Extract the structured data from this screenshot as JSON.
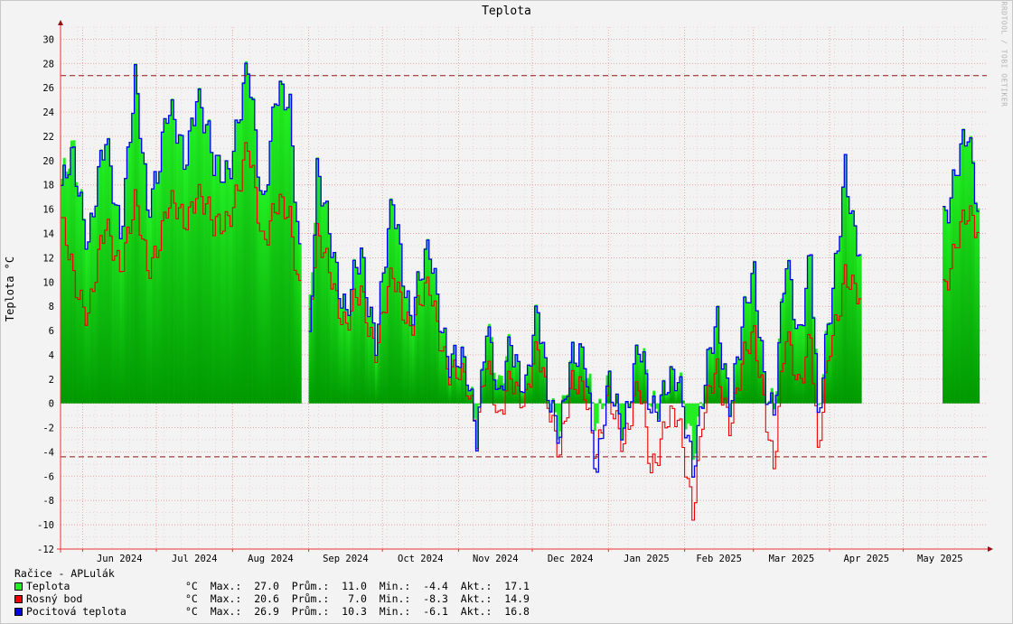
{
  "chart_data": {
    "type": "area",
    "title": "Teplota",
    "ylabel": "Teplota °C",
    "ylim": [
      -12,
      31
    ],
    "ytick_step": 2,
    "grid": true,
    "x_start": "2024-05-23",
    "x_end": "2025-06-04",
    "month_labels": [
      {
        "label": "Jun 2024",
        "date": "2024-06-01"
      },
      {
        "label": "Jul 2024",
        "date": "2024-07-01"
      },
      {
        "label": "Aug 2024",
        "date": "2024-08-01"
      },
      {
        "label": "Sep 2024",
        "date": "2024-09-01"
      },
      {
        "label": "Oct 2024",
        "date": "2024-10-01"
      },
      {
        "label": "Nov 2024",
        "date": "2024-11-01"
      },
      {
        "label": "Dec 2024",
        "date": "2024-12-01"
      },
      {
        "label": "Jan 2025",
        "date": "2025-01-01"
      },
      {
        "label": "Feb 2025",
        "date": "2025-02-01"
      },
      {
        "label": "Mar 2025",
        "date": "2025-03-01"
      },
      {
        "label": "Apr 2025",
        "date": "2025-04-01"
      },
      {
        "label": "May 2025",
        "date": "2025-05-01"
      }
    ],
    "reference_lines": [
      27.0,
      -4.4
    ],
    "gaps": [
      [
        "2024-08-29",
        "2024-08-31"
      ],
      [
        "2025-04-14",
        "2025-05-16"
      ]
    ],
    "key_points": [
      {
        "date": "2024-05-23",
        "temp": 17.5,
        "dew": 14.5,
        "feel": 17.0
      },
      {
        "date": "2024-05-28",
        "temp": 20.5,
        "dew": 10.0,
        "feel": 20.0
      },
      {
        "date": "2024-06-03",
        "temp": 14.0,
        "dew": 8.0,
        "feel": 14.0
      },
      {
        "date": "2024-06-10",
        "temp": 21.0,
        "dew": 14.0,
        "feel": 21.0
      },
      {
        "date": "2024-06-16",
        "temp": 15.0,
        "dew": 12.0,
        "feel": 15.0
      },
      {
        "date": "2024-06-22",
        "temp": 26.0,
        "dew": 16.0,
        "feel": 26.0
      },
      {
        "date": "2024-06-27",
        "temp": 16.0,
        "dew": 11.0,
        "feel": 16.0
      },
      {
        "date": "2024-07-05",
        "temp": 24.0,
        "dew": 16.0,
        "feel": 24.0
      },
      {
        "date": "2024-07-12",
        "temp": 20.0,
        "dew": 15.0,
        "feel": 20.0
      },
      {
        "date": "2024-07-17",
        "temp": 26.3,
        "dew": 18.0,
        "feel": 26.2
      },
      {
        "date": "2024-07-24",
        "temp": 19.0,
        "dew": 14.0,
        "feel": 19.0
      },
      {
        "date": "2024-07-30",
        "temp": 20.0,
        "dew": 16.0,
        "feel": 20.0
      },
      {
        "date": "2024-08-04",
        "temp": 24.0,
        "dew": 18.0,
        "feel": 24.0
      },
      {
        "date": "2024-08-07",
        "temp": 27.0,
        "dew": 20.6,
        "feel": 26.9
      },
      {
        "date": "2024-08-13",
        "temp": 17.0,
        "dew": 14.0,
        "feel": 17.0
      },
      {
        "date": "2024-08-18",
        "temp": 25.0,
        "dew": 16.0,
        "feel": 25.0
      },
      {
        "date": "2024-08-24",
        "temp": 24.0,
        "dew": 15.0,
        "feel": 24.0
      },
      {
        "date": "2024-08-28",
        "temp": 13.0,
        "dew": 10.0,
        "feel": 13.0
      },
      {
        "date": "2024-09-01",
        "temp": 8.0,
        "dew": 7.0,
        "feel": 5.0
      },
      {
        "date": "2024-09-04",
        "temp": 18.0,
        "dew": 13.0,
        "feel": 18.0
      },
      {
        "date": "2024-09-10",
        "temp": 14.0,
        "dew": 11.0,
        "feel": 14.0
      },
      {
        "date": "2024-09-16",
        "temp": 7.0,
        "dew": 6.0,
        "feel": 7.0
      },
      {
        "date": "2024-09-22",
        "temp": 12.0,
        "dew": 9.0,
        "feel": 12.0
      },
      {
        "date": "2024-09-28",
        "temp": 6.0,
        "dew": 5.0,
        "feel": 6.0
      },
      {
        "date": "2024-10-05",
        "temp": 16.0,
        "dew": 10.0,
        "feel": 16.0
      },
      {
        "date": "2024-10-12",
        "temp": 8.0,
        "dew": 7.0,
        "feel": 8.0
      },
      {
        "date": "2024-10-20",
        "temp": 12.0,
        "dew": 9.0,
        "feel": 12.0
      },
      {
        "date": "2024-10-28",
        "temp": 4.0,
        "dew": 3.0,
        "feel": 4.0
      },
      {
        "date": "2024-11-04",
        "temp": 2.0,
        "dew": 1.0,
        "feel": 2.0
      },
      {
        "date": "2024-11-08",
        "temp": -1.5,
        "dew": -1.5,
        "feel": -1.8
      },
      {
        "date": "2024-11-12",
        "temp": 7.0,
        "dew": 4.0,
        "feel": 7.0
      },
      {
        "date": "2024-11-17",
        "temp": 0.0,
        "dew": -2.5,
        "feel": -1.0
      },
      {
        "date": "2024-11-22",
        "temp": 6.0,
        "dew": 3.0,
        "feel": 6.0
      },
      {
        "date": "2024-11-28",
        "temp": 1.0,
        "dew": 0.0,
        "feel": 1.0
      },
      {
        "date": "2024-12-03",
        "temp": 7.0,
        "dew": 4.0,
        "feel": 7.0
      },
      {
        "date": "2024-12-07",
        "temp": 2.0,
        "dew": 1.0,
        "feel": 2.0
      },
      {
        "date": "2024-12-12",
        "temp": -2.0,
        "dew": -4.0,
        "feel": -2.5
      },
      {
        "date": "2024-12-17",
        "temp": 3.0,
        "dew": 1.0,
        "feel": 3.0
      },
      {
        "date": "2024-12-22",
        "temp": 5.0,
        "dew": 2.0,
        "feel": 5.0
      },
      {
        "date": "2024-12-27",
        "temp": -2.0,
        "dew": -4.5,
        "feel": -6.0
      },
      {
        "date": "2025-01-01",
        "temp": 1.0,
        "dew": 0.0,
        "feel": 1.0
      },
      {
        "date": "2025-01-07",
        "temp": -1.0,
        "dew": -2.5,
        "feel": -1.0
      },
      {
        "date": "2025-01-13",
        "temp": 4.0,
        "dew": 1.0,
        "feel": 4.0
      },
      {
        "date": "2025-01-18",
        "temp": 0.0,
        "dew": -5.5,
        "feel": -0.5
      },
      {
        "date": "2025-01-24",
        "temp": 2.0,
        "dew": -1.0,
        "feel": 2.0
      },
      {
        "date": "2025-01-29",
        "temp": 1.0,
        "dew": -2.0,
        "feel": 1.0
      },
      {
        "date": "2025-02-04",
        "temp": -3.0,
        "dew": -8.3,
        "feel": -4.5
      },
      {
        "date": "2025-02-08",
        "temp": 1.0,
        "dew": -1.0,
        "feel": 1.0
      },
      {
        "date": "2025-02-14",
        "temp": 6.0,
        "dew": 2.0,
        "feel": 6.0
      },
      {
        "date": "2025-02-19",
        "temp": 1.0,
        "dew": -1.0,
        "feel": 1.0
      },
      {
        "date": "2025-02-24",
        "temp": 6.0,
        "dew": 3.0,
        "feel": 6.0
      },
      {
        "date": "2025-03-01",
        "temp": 10.0,
        "dew": 5.0,
        "feel": 10.0
      },
      {
        "date": "2025-03-05",
        "temp": 3.0,
        "dew": 1.0,
        "feel": 3.0
      },
      {
        "date": "2025-03-09",
        "temp": 0.0,
        "dew": -5.0,
        "feel": -0.5
      },
      {
        "date": "2025-03-14",
        "temp": 11.0,
        "dew": 5.0,
        "feel": 11.0
      },
      {
        "date": "2025-03-19",
        "temp": 6.0,
        "dew": 2.0,
        "feel": 6.0
      },
      {
        "date": "2025-03-24",
        "temp": 13.0,
        "dew": 6.0,
        "feel": 13.0
      },
      {
        "date": "2025-03-27",
        "temp": -2.0,
        "dew": -5.1,
        "feel": -2.5
      },
      {
        "date": "2025-04-01",
        "temp": 8.0,
        "dew": 5.0,
        "feel": 8.0
      },
      {
        "date": "2025-04-07",
        "temp": 20.0,
        "dew": 11.0,
        "feel": 20.0
      },
      {
        "date": "2025-04-10",
        "temp": 14.0,
        "dew": 9.0,
        "feel": 14.0
      },
      {
        "date": "2025-04-13",
        "temp": 11.5,
        "dew": 8.0,
        "feel": 11.5
      },
      {
        "date": "2025-05-17",
        "temp": 16.0,
        "dew": 10.0,
        "feel": 16.0
      },
      {
        "date": "2025-05-22",
        "temp": 19.0,
        "dew": 13.0,
        "feel": 19.0
      },
      {
        "date": "2025-05-27",
        "temp": 21.5,
        "dew": 15.0,
        "feel": 21.5
      },
      {
        "date": "2025-05-31",
        "temp": 17.1,
        "dew": 14.9,
        "feel": 16.8
      }
    ],
    "colors": {
      "temp_light": "#22ee22",
      "temp_dark": "#009900",
      "dew": "#ee0000",
      "feel": "#0000ee",
      "ref_line": "#991111"
    }
  },
  "legend": {
    "station": "Račice - APLulák",
    "unit": "°C",
    "max_label": "Max.:",
    "avg_label": "Prům.:",
    "min_label": "Min.:",
    "cur_label": "Akt.:",
    "items": [
      {
        "name": "Teplota",
        "color": "#22ee22",
        "max": "27.0",
        "avg": "11.0",
        "min": "-4.4",
        "cur": "17.1"
      },
      {
        "name": "Rosný bod",
        "color": "#ee0000",
        "max": "20.6",
        "avg": " 7.0",
        "min": "-8.3",
        "cur": "14.9"
      },
      {
        "name": "Pocitová teplota",
        "color": "#0000ee",
        "max": "26.9",
        "avg": "10.3",
        "min": "-6.1",
        "cur": "16.8"
      }
    ]
  },
  "watermark": "RRDTOOL / TOBI OETIKER"
}
